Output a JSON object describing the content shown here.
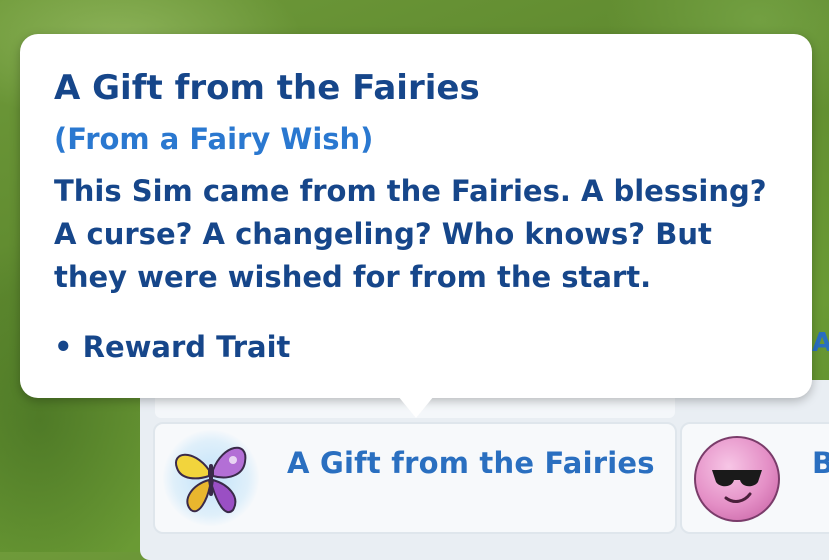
{
  "tooltip": {
    "title": "A Gift from the Fairies",
    "subtitle": "(From a Fairy Wish)",
    "description": "This Sim came from the Fairies. A blessing? A curse? A changeling? Who knows? But they were wished for from the start.",
    "bullet": "• Reward Trait"
  },
  "traits": {
    "selected": {
      "name": "A Gift from the Fairies",
      "icon": "butterfly-icon"
    },
    "next": {
      "name_partial": "B",
      "icon": "sunglasses-face-icon"
    },
    "edge_label": "A"
  },
  "colors": {
    "title": "#16468a",
    "subtitle": "#2a78d0",
    "trait_name": "#2a6fc0",
    "background": "#6a9a34"
  }
}
